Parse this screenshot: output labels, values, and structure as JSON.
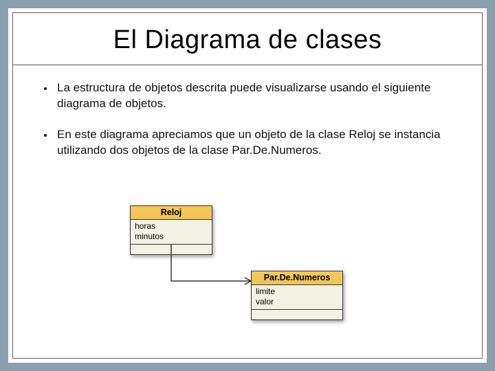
{
  "slide": {
    "title": "El Diagrama de clases",
    "bullets": [
      "La estructura de objetos descrita puede visualizarse usando el siguiente diagrama de objetos.",
      "En este diagrama apreciamos que un objeto de la clase Reloj se instancia utilizando dos objetos de la clase Par.De.Numeros."
    ]
  },
  "diagram": {
    "classes": [
      {
        "name": "Reloj",
        "attributes": [
          "horas",
          "minutos"
        ]
      },
      {
        "name": "Par.De.Numeros",
        "attributes": [
          "limite",
          "valor"
        ]
      }
    ]
  }
}
